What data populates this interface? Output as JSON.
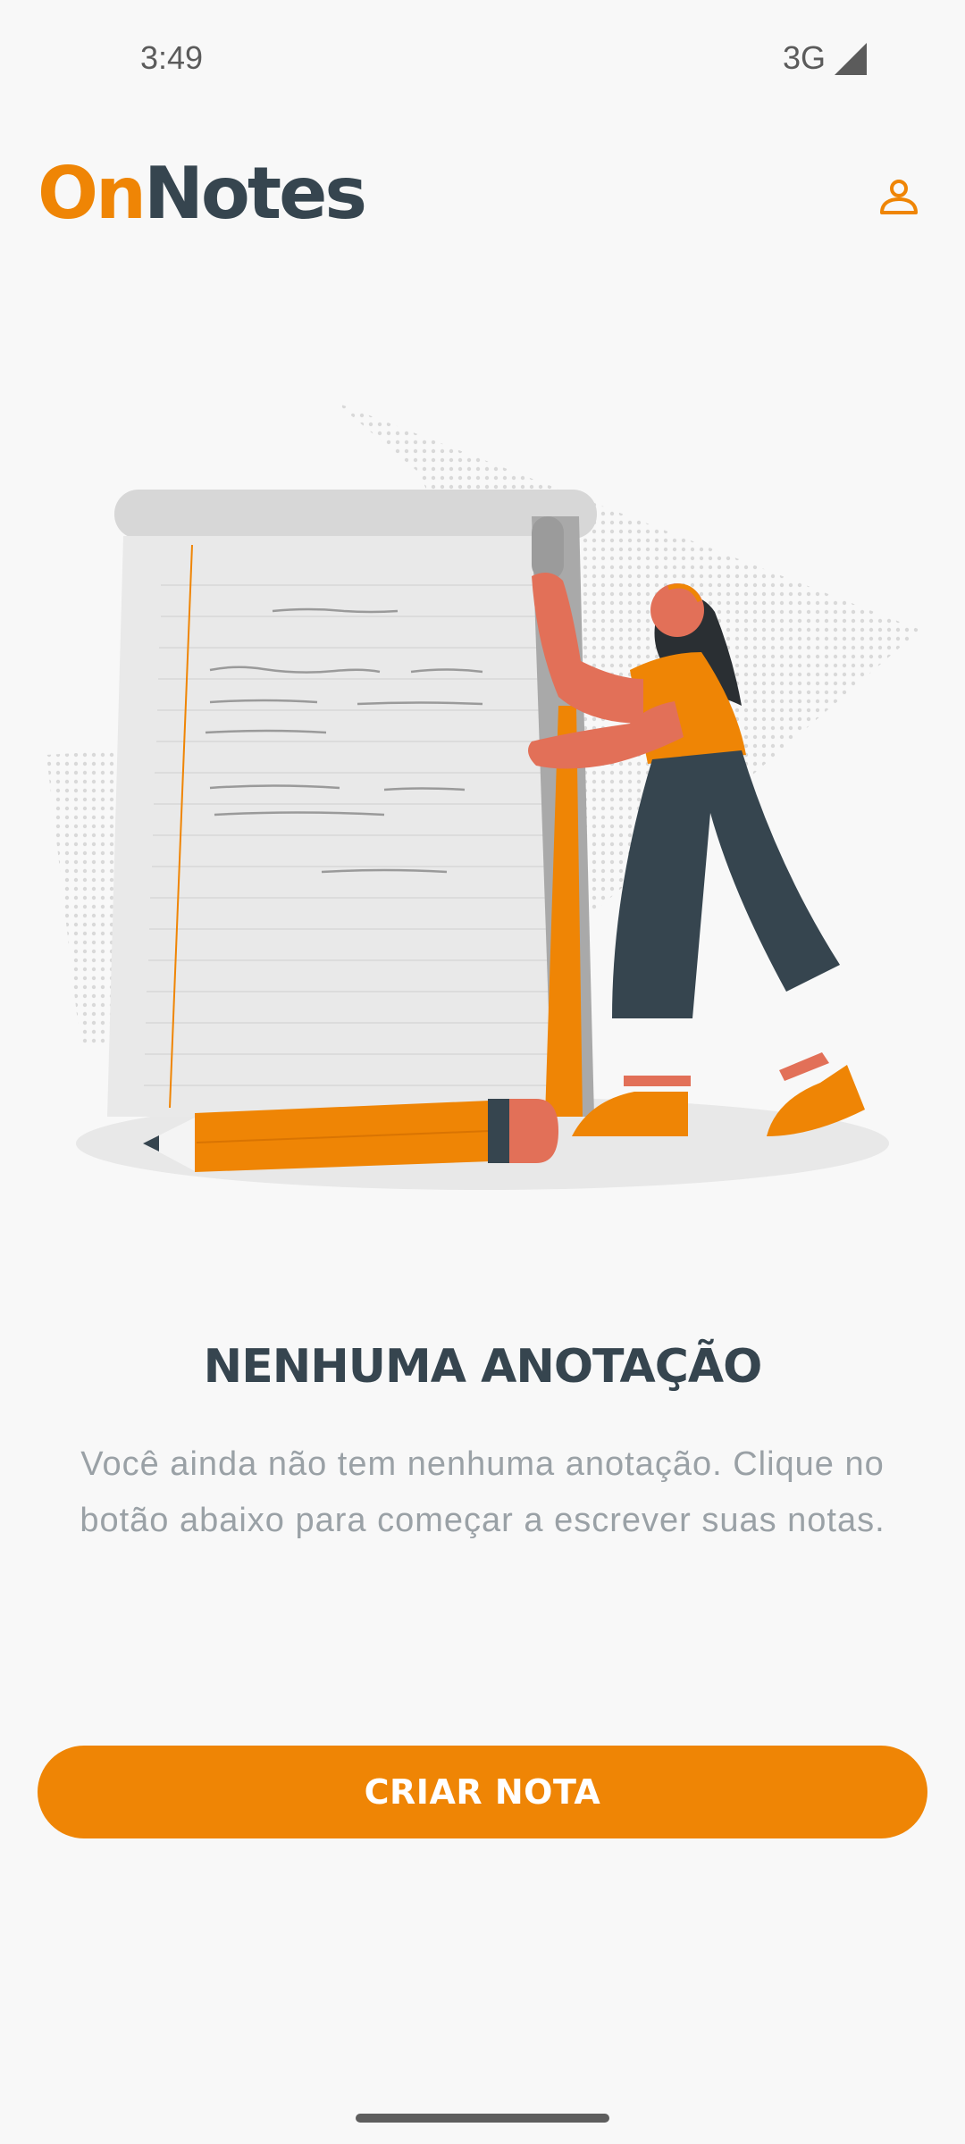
{
  "status_bar": {
    "time": "3:49",
    "network": "3G",
    "signal_icon": "cell-signal-icon"
  },
  "header": {
    "logo_part1": "On",
    "logo_part2": "Notes",
    "profile_icon": "user-profile-icon"
  },
  "illustration": {
    "icon": "notepad-woman-illustration"
  },
  "empty_state": {
    "title": "NENHUMA ANOTAÇÃO",
    "description": "Você ainda não tem nenhuma anotação. Clique no botão abaixo para começar a escrever suas notas."
  },
  "actions": {
    "create_label": "CRIAR NOTA"
  },
  "colors": {
    "accent": "#ef8505",
    "dark": "#36454f",
    "text_muted": "#9aa1a6",
    "background": "#f8f8f8"
  }
}
